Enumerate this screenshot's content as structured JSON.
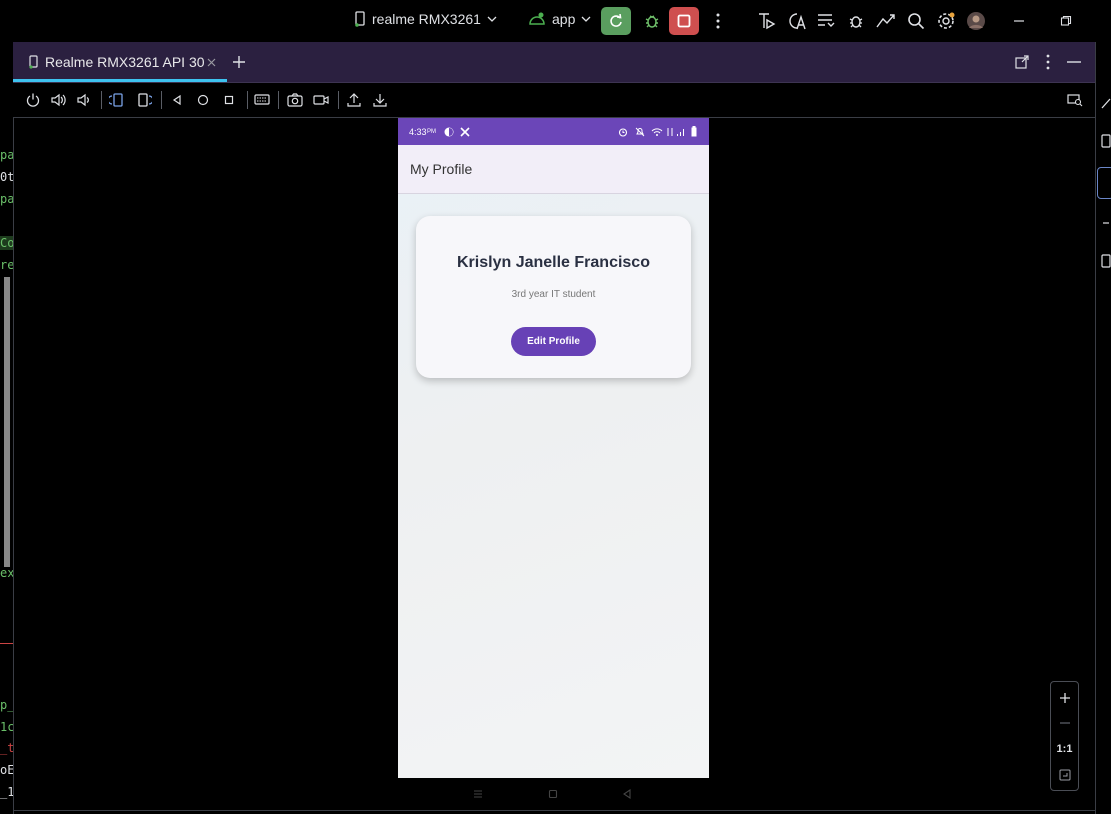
{
  "topbar": {
    "device_name": "realme RMX3261",
    "run_config": "app"
  },
  "tab": {
    "title": "Realme RMX3261 API 30"
  },
  "leftstrip": {
    "lines": [
      "pa",
      "0t",
      "pa",
      "Co",
      "re",
      "ex",
      "p_",
      "1c",
      "_t",
      "oE",
      "_1"
    ]
  },
  "phone": {
    "status": {
      "time": "4:33",
      "ampm": "PM"
    },
    "appbar_title": "My Profile",
    "profile": {
      "name": "Krislyn Janelle Francisco",
      "role": "3rd year IT student",
      "edit_button": "Edit Profile"
    }
  },
  "zoom": {
    "one_to_one": "1:1"
  },
  "colors": {
    "accent_purple": "#6b46b8",
    "run_green": "#5a9e5f",
    "stop_red": "#cf4f4f",
    "tab_underline": "#3ec3f0"
  }
}
